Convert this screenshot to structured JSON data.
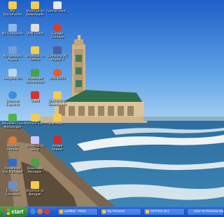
{
  "desktop": {
    "icons": [
      {
        "label": "My Documents",
        "icon": "folder-icon"
      },
      {
        "label": "Shortcut to Downloads",
        "icon": "folder-icon"
      },
      {
        "label": "Format conf...",
        "icon": "document-icon"
      },
      {
        "label": "My Computer",
        "icon": "computer-icon"
      },
      {
        "label": "VPN Client",
        "icon": "vpn-icon"
      },
      {
        "label": "Google Chrome",
        "icon": "chrome-icon"
      },
      {
        "label": "My Network Places",
        "icon": "network-icon"
      },
      {
        "label": "Shortcut to Office",
        "icon": "folder-icon"
      },
      {
        "label": "Samsung PC Studio 7",
        "icon": "phone-icon"
      },
      {
        "label": "Recycle Bin",
        "icon": "recycle-bin-icon"
      },
      {
        "label": "Download Accelerator",
        "icon": "download-icon"
      },
      {
        "label": "AVG 2012",
        "icon": "avg-icon"
      },
      {
        "label": "Internet Explorer",
        "icon": "internet-explorer-icon"
      },
      {
        "label": "Trend",
        "icon": "trend-icon"
      },
      {
        "label": "Shortcut to Downloads",
        "icon": "folder-icon"
      },
      {
        "label": "Windows Live Messenger",
        "icon": "messenger-icon"
      },
      {
        "label": "Mahavir Lal...",
        "icon": "folder-icon"
      },
      {
        "label": "Bachelor...",
        "icon": "folder-icon"
      },
      {
        "label": "Mozilla Firefox",
        "icon": "firefox-icon"
      },
      {
        "label": "Shortcut to Song",
        "icon": "music-icon"
      },
      {
        "label": "Adobe Reader",
        "icon": "adobe-reader-icon"
      },
      {
        "label": "Advanced Sys Manager",
        "icon": "system-tool-icon"
      },
      {
        "label": "Download Manager",
        "icon": "download-icon"
      },
      {
        "label": "E-Quran Contacts",
        "icon": "book-icon"
      },
      {
        "label": "Shortcut to Bengali",
        "icon": "folder-icon"
      }
    ]
  },
  "taskbar": {
    "start_label": "start",
    "quick_launch": [
      {
        "icon": "internet-explorer-icon"
      },
      {
        "icon": "firefox-icon"
      },
      {
        "icon": "chrome-icon"
      }
    ],
    "tasks": [
      {
        "label": "untitled - Paint",
        "icon": "paint-icon"
      },
      {
        "label": "My Pictures",
        "icon": "folder-icon"
      },
      {
        "label": "OFFICE (E:)",
        "icon": "folder-icon"
      },
      {
        "label": "How To Remove Bai...",
        "icon": "internet-explorer-icon"
      }
    ]
  },
  "colors": {
    "sky": "#4b8fd8",
    "sea": "#2f6fa0",
    "taskbar": "#245edb",
    "start_green": "#3b8f37"
  }
}
